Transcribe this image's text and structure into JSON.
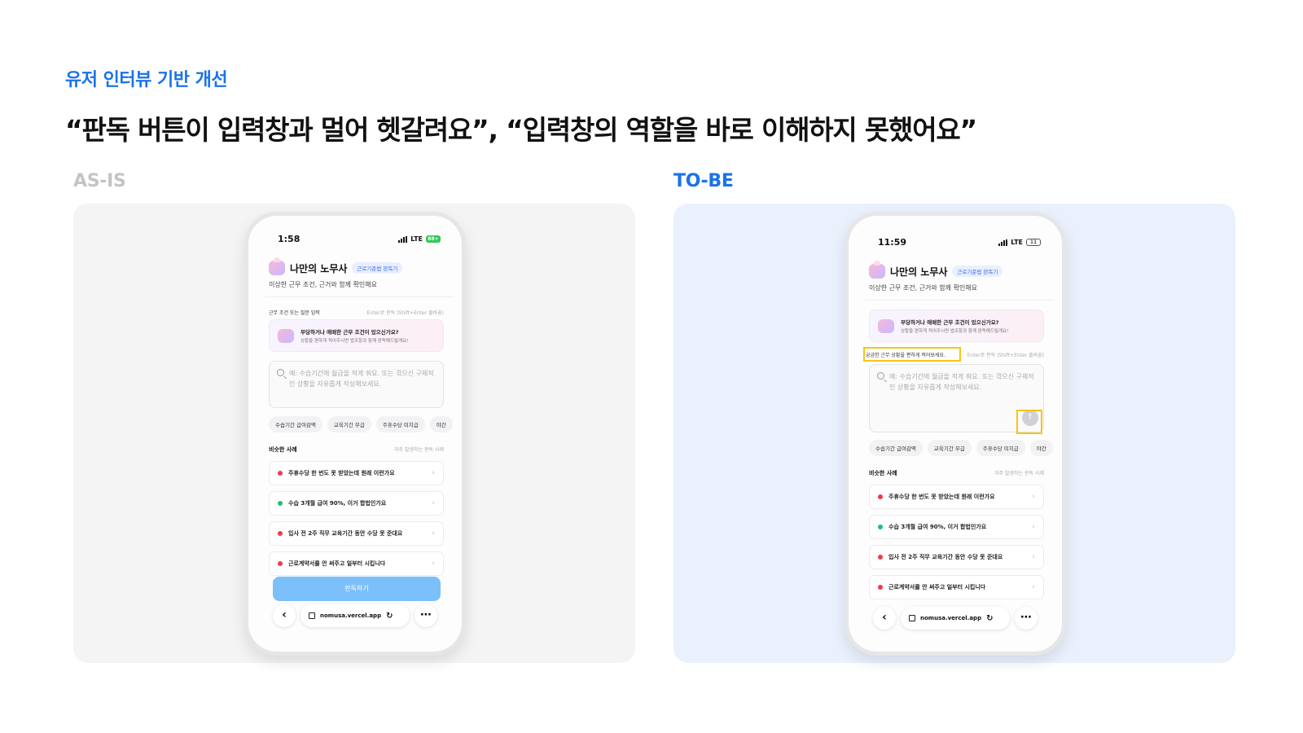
{
  "slide": {
    "eyebrow": "유저 인터뷰 기반 개선",
    "headline": "“판독 버튼이 입력창과 멀어 헷갈려요”, “입력창의 역할을 바로 이해하지 못했어요”",
    "asis_label": "AS-IS",
    "tobe_label": "TO-BE"
  },
  "asis": {
    "time": "1:58",
    "network": "LTE",
    "battery": "88+",
    "input_label": "근무 조건 또는 질문 입력",
    "input_hint": "Enter로 판독 (Shift+Enter 줄바꿈)",
    "cta_label": "판독하기"
  },
  "tobe": {
    "time": "11:59",
    "network": "LTE",
    "battery": "11",
    "input_label": "궁금한 근무 상황을 편하게 적어보세요.",
    "input_hint": "Enter로 판독 (Shift+Enter 줄바꿈)",
    "send_icon": "arrow-up-icon"
  },
  "common": {
    "app_name": "나만의 노무사",
    "app_tag": "근로기준법 판독기",
    "app_sub": "이상한 근무 조건, 근거와 함께 확인해요",
    "info_title": "부당하거나 애매한 근무 조건이 있으신가요?",
    "info_desc": "상황을 편하게 적어주시면 법조항과 함께 판독해드릴게요!",
    "textarea_placeholder": "예: 수습기간에 월급을 적게 줘요. 또는 겪으신 구체적인 상황을 자유롭게 작성해보세요.",
    "chips": [
      "수습기간 급여감액",
      "교육기간 무급",
      "주휴수당 미지급",
      "야간"
    ],
    "similar_title": "비슷한 사례",
    "similar_sub": "자주 발생하는 판독 사례",
    "cases": [
      {
        "text": "주휴수당 한 번도 못 받았는데 원래 이런가요",
        "color": "#f03a4a"
      },
      {
        "text": "수습 3개월 급여 90%, 이거 합법인가요",
        "color": "#1fbf75"
      },
      {
        "text": "입사 전 2주 직무 교육기간 동안 수당 못 준대요",
        "color": "#f03a4a"
      },
      {
        "text": "근로계약서를 안 써주고 일부터 시킵니다",
        "color": "#f03a4a"
      }
    ],
    "url": "nomusa.vercel.app",
    "back_icon": "chevron-left-icon",
    "more_icon": "more-icon"
  }
}
